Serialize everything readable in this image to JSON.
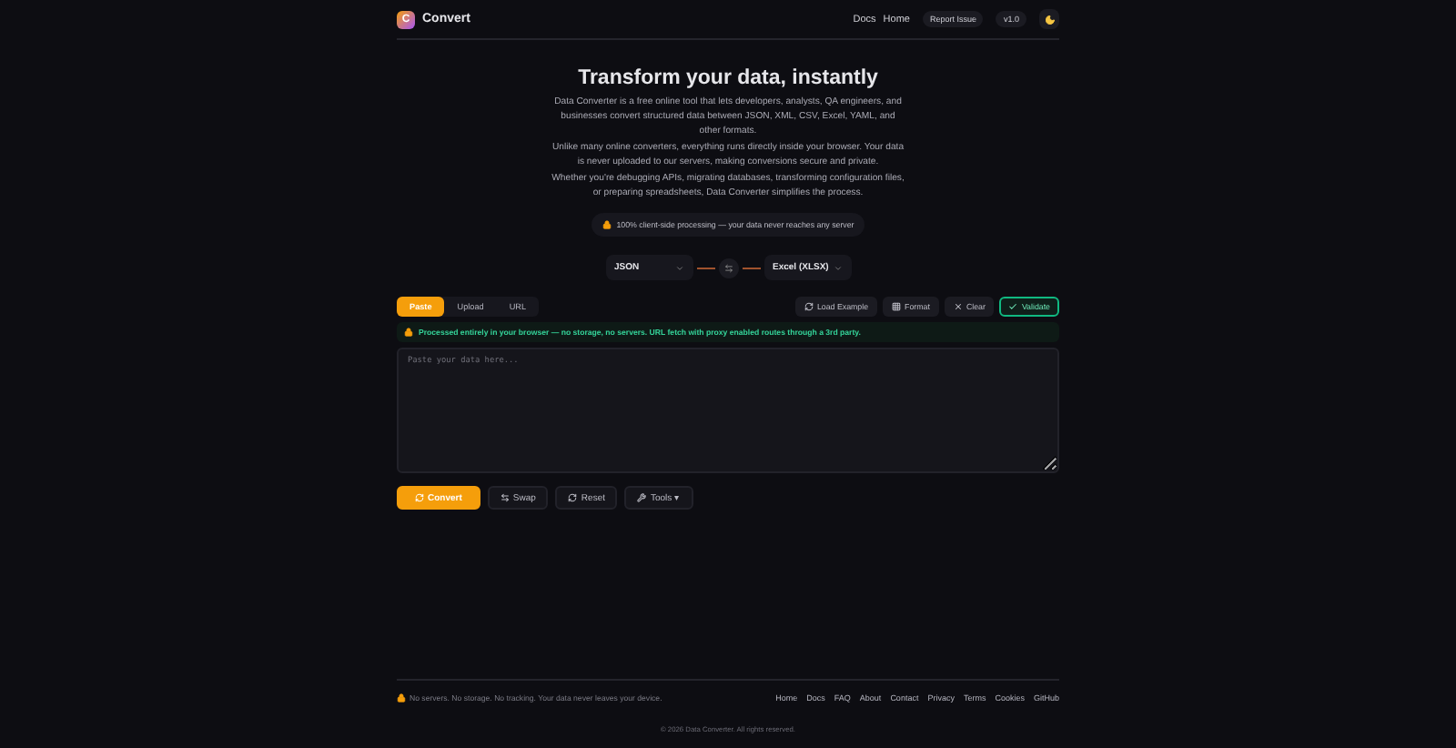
{
  "header": {
    "brand": "Convert",
    "logo_letter": "C",
    "nav": [
      "Docs",
      "Home"
    ],
    "buttons": [
      "Report Issue",
      "v1.0"
    ]
  },
  "hero": {
    "title": "Transform your data, instantly",
    "paragraphs": [
      "Data Converter is a free online tool that lets developers, analysts, QA engineers, and businesses convert structured data between JSON, XML, CSV, Excel, YAML, and other formats.",
      "Unlike many online converters, everything runs directly inside your browser. Your data is never uploaded to our servers, making conversions secure and private.",
      "Whether you're debugging APIs, migrating databases, transforming configuration files, or preparing spreadsheets, Data Converter simplifies the process."
    ],
    "badge": "100% client-side processing — your data never reaches any server"
  },
  "formats": {
    "from": "JSON",
    "to": "Excel (XLSX)"
  },
  "tabs": [
    {
      "label": "Paste",
      "selected": true
    },
    {
      "label": "Upload",
      "selected": false
    },
    {
      "label": "URL",
      "selected": false
    }
  ],
  "actions": [
    {
      "label": "Load Example",
      "kind": "example",
      "highlighted": false
    },
    {
      "label": "Format",
      "kind": "format",
      "highlighted": false
    },
    {
      "label": "Clear",
      "kind": "clear",
      "highlighted": false
    },
    {
      "label": "Validate",
      "kind": "validate",
      "highlighted": true
    }
  ],
  "notice": "Processed entirely in your browser — no storage, no servers. URL fetch with proxy enabled routes through a 3rd party.",
  "editor": {
    "placeholder": "Paste your data here..."
  },
  "buttons": [
    {
      "label": "Convert",
      "kind": "convert",
      "primary": true
    },
    {
      "label": "Swap",
      "kind": "swap",
      "primary": false
    },
    {
      "label": "Reset",
      "kind": "reset",
      "primary": false
    },
    {
      "label": "Tools",
      "kind": "tools",
      "primary": false,
      "caret": "▾"
    }
  ],
  "footer": {
    "note": "No servers. No storage. No tracking. Your data never leaves your device.",
    "links": [
      "Home",
      "Docs",
      "FAQ",
      "About",
      "Contact",
      "Privacy",
      "Terms",
      "Cookies",
      "GitHub"
    ],
    "copyright": "© 2026 Data Converter. All rights reserved."
  }
}
